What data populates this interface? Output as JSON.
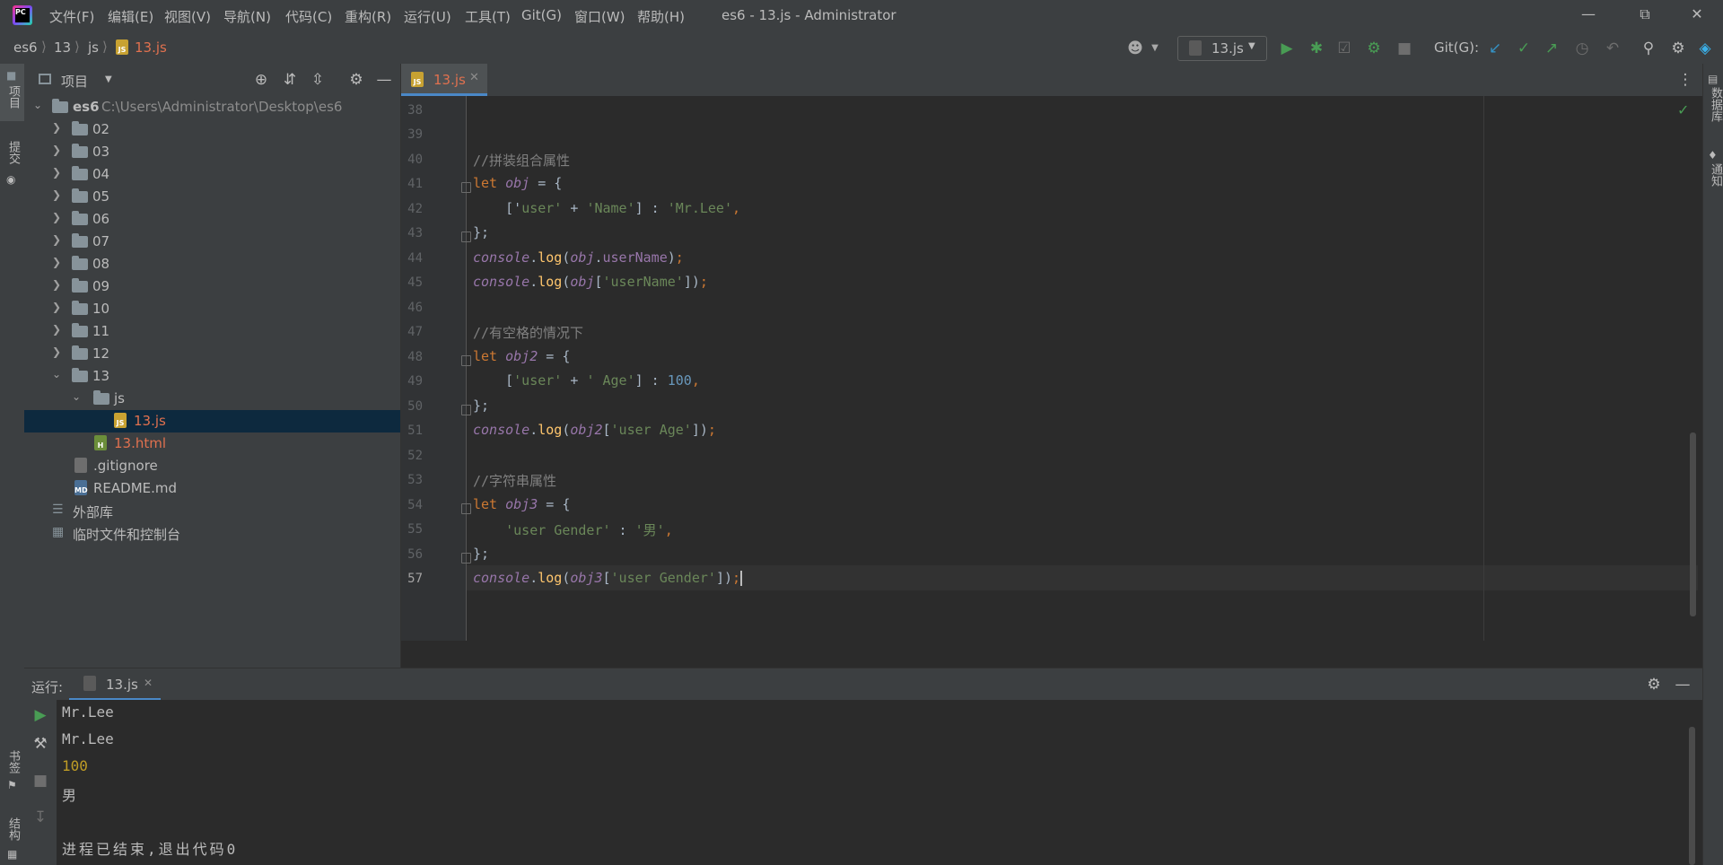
{
  "app": {
    "logo_text": "PC"
  },
  "menu": [
    "文件(F)",
    "编辑(E)",
    "视图(V)",
    "导航(N)",
    "代码(C)",
    "重构(R)",
    "运行(U)",
    "工具(T)",
    "Git(G)",
    "窗口(W)",
    "帮助(H)"
  ],
  "window_title": "es6 - 13.js - Administrator",
  "breadcrumb": [
    "es6",
    "13",
    "js",
    "13.js"
  ],
  "toolbar": {
    "run_config": "13.js",
    "git_label": "Git(G):"
  },
  "left_stripe": {
    "project": "项目",
    "commit": "提交",
    "bookmarks": "书签",
    "structure": "结构"
  },
  "right_stripe": {
    "database": "数据库",
    "notifications": "通知"
  },
  "project_panel": {
    "title": "项目",
    "root": {
      "name": "es6",
      "path": "C:\\Users\\Administrator\\Desktop\\es6"
    },
    "folders": [
      "02",
      "03",
      "04",
      "05",
      "06",
      "07",
      "08",
      "09",
      "10",
      "11",
      "12",
      "13"
    ],
    "js_folder": "js",
    "selected_file": "13.js",
    "html_file": "13.html",
    "files": [
      ".gitignore",
      "README.md"
    ],
    "external_libs": "外部库",
    "scratches": "临时文件和控制台"
  },
  "editor": {
    "tab": "13.js",
    "line_numbers": [
      "38",
      "39",
      "40",
      "41",
      "42",
      "43",
      "44",
      "45",
      "46",
      "47",
      "48",
      "49",
      "50",
      "51",
      "52",
      "53",
      "54",
      "55",
      "56",
      "57"
    ],
    "lines": {
      "l40": "//拼装组合属性",
      "l41_kw": "let",
      "l41_var": "obj",
      "l41_rest": " = {",
      "l42_a": "['",
      "l42_s1": "user'",
      "l42_b": " + ",
      "l42_s2": "'Name'",
      "l42_c": "] : ",
      "l42_s3": "'Mr.Lee'",
      "l42_d": ",",
      "l43": "};",
      "l44_con": "console",
      "l44_fn": "log",
      "l44_var": "obj",
      "l44_prop": "userName",
      "l45_con": "console",
      "l45_fn": "log",
      "l45_var": "obj",
      "l45_str": "'userName'",
      "l47": "//有空格的情况下",
      "l48_kw": "let",
      "l48_var": "obj2",
      "l48_rest": " = {",
      "l49_s1": "'user'",
      "l49_s2": "' Age'",
      "l49_num": "100",
      "l50": "};",
      "l51_con": "console",
      "l51_fn": "log",
      "l51_var": "obj2",
      "l51_str": "'user Age'",
      "l53": "//字符串属性",
      "l54_kw": "let",
      "l54_var": "obj3",
      "l54_rest": " = {",
      "l55_s1": "'user Gender'",
      "l55_s2": "'男'",
      "l56": "};",
      "l57_con": "console",
      "l57_fn": "log",
      "l57_var": "obj3",
      "l57_str": "'user Gender'"
    }
  },
  "run_panel": {
    "label": "运行:",
    "tab": "13.js",
    "output": [
      "Mr.Lee",
      "Mr.Lee",
      "100",
      "男",
      "",
      "进程已结束,退出代码0"
    ]
  },
  "colors": {
    "accent": "#4a88c7",
    "run_green": "#499c54",
    "number": "#bf9c25",
    "error_red": "#e0714f"
  }
}
